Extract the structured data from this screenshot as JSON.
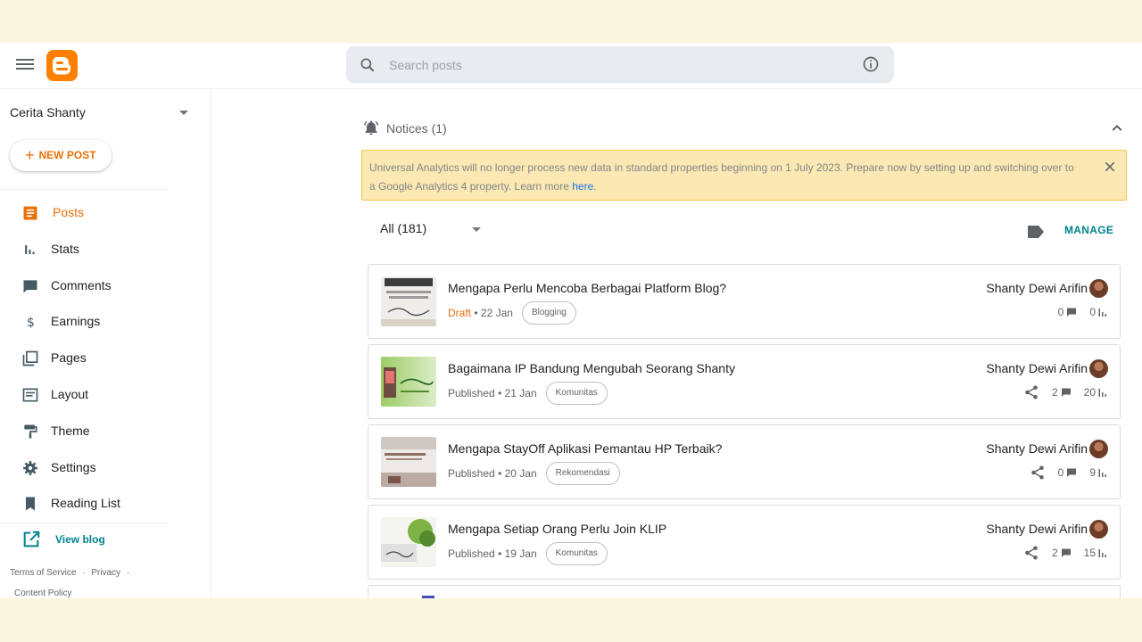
{
  "header": {
    "search_placeholder": "Search posts",
    "logo": "blogger-logo"
  },
  "sidebar": {
    "blog_name": "Cerita Shanty",
    "new_post_label": "NEW POST",
    "items": [
      {
        "label": "Posts",
        "icon": "posts-icon",
        "active": true
      },
      {
        "label": "Stats",
        "icon": "stats-icon",
        "active": false
      },
      {
        "label": "Comments",
        "icon": "comments-icon",
        "active": false
      },
      {
        "label": "Earnings",
        "icon": "dollar-icon",
        "active": false
      },
      {
        "label": "Pages",
        "icon": "pages-icon",
        "active": false
      },
      {
        "label": "Layout",
        "icon": "layout-icon",
        "active": false
      },
      {
        "label": "Theme",
        "icon": "paint-roller-icon",
        "active": false
      },
      {
        "label": "Settings",
        "icon": "gear-icon",
        "active": false
      },
      {
        "label": "Reading List",
        "icon": "bookmark-icon",
        "active": false
      }
    ],
    "view_blog_label": "View blog",
    "footer": {
      "terms": "Terms of Service",
      "privacy": "Privacy",
      "content_policy": "Content Policy",
      "separator": "·"
    }
  },
  "main": {
    "notices_label": "Notices (1)",
    "notice_text": "Universal Analytics will no longer process new data in standard properties beginning on 1 July 2023. Prepare now by setting up and switching over to a Google Analytics 4 property. Learn more ",
    "notice_link": "here",
    "notice_end": ".",
    "filter_label": "All (181)",
    "manage_label": "MANAGE",
    "posts": [
      {
        "title": "Mengapa Perlu Mencoba Berbagai Platform Blog?",
        "status": "Draft",
        "date": "• 22 Jan",
        "label": "Blogging",
        "author": "Shanty Dewi Arifin",
        "comments": "0",
        "views": "0",
        "shareable": false
      },
      {
        "title": "Bagaimana IP Bandung Mengubah Seorang Shanty",
        "status": "Published",
        "date": "• 21 Jan",
        "label": "Komunitas",
        "author": "Shanty Dewi Arifin",
        "comments": "2",
        "views": "20",
        "shareable": true
      },
      {
        "title": "Mengapa StayOff Aplikasi Pemantau HP Terbaik?",
        "status": "Published",
        "date": "• 20 Jan",
        "label": "Rekomendasi",
        "author": "Shanty Dewi Arifin",
        "comments": "0",
        "views": "9",
        "shareable": true
      },
      {
        "title": "Mengapa Setiap Orang Perlu Join KLIP",
        "status": "Published",
        "date": "• 19 Jan",
        "label": "Komunitas",
        "author": "Shanty Dewi Arifin",
        "comments": "2",
        "views": "15",
        "shareable": true
      }
    ]
  },
  "colors": {
    "accent": "#e8710a",
    "teal": "#00838f",
    "notice_bg": "#fce8b2",
    "page_bg": "#fbf6de"
  }
}
